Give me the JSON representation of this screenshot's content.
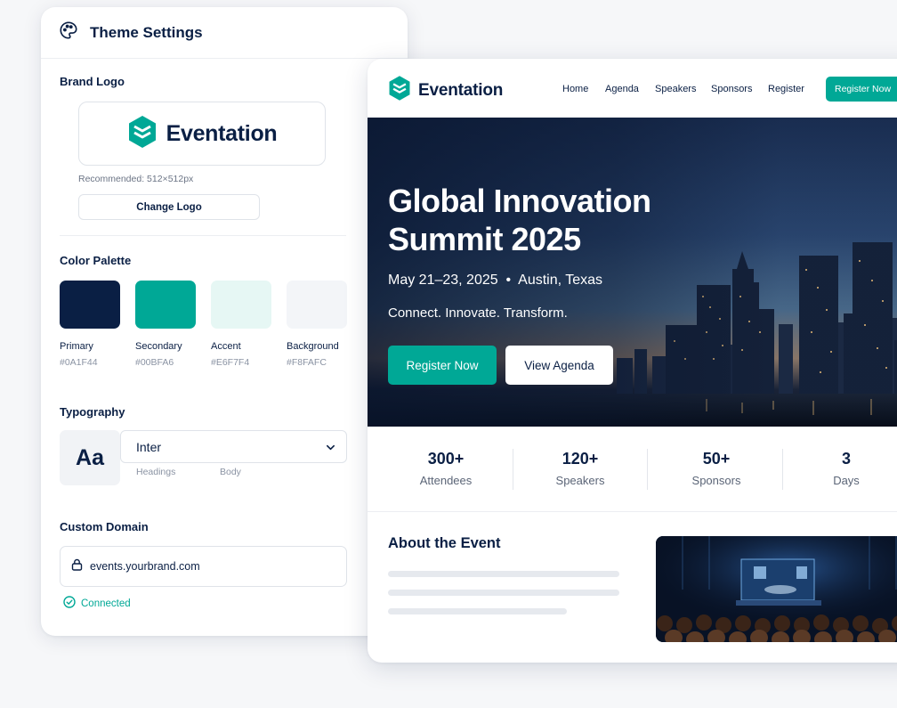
{
  "colors": {
    "primary": "#0A1F44",
    "secondary": "#00A896",
    "accent": "#E6F7F4",
    "background": "#F8FAFC"
  },
  "settings": {
    "title": "Theme Settings",
    "title_icon": "palette-icon",
    "brand_logo": {
      "label": "Brand Logo",
      "logo_text": "Eventation",
      "logo_icon": "hexagon-logo-icon",
      "recommendation": "Recommended: 512×512px",
      "change_button": "Change Logo"
    },
    "color_palette": {
      "label": "Color Palette",
      "swatches": [
        {
          "name": "Primary",
          "hex": "#0A1F44"
        },
        {
          "name": "Secondary",
          "hex": "#00BFA6"
        },
        {
          "name": "Accent",
          "hex": "#E6F7F4"
        },
        {
          "name": "Background",
          "hex": "#F8FAFC"
        }
      ]
    },
    "typography": {
      "label": "Typography",
      "preview": "Aa",
      "font": "Inter",
      "headings_label": "Headings",
      "body_label": "Body"
    },
    "custom_domain": {
      "label": "Custom Domain",
      "value": "events.yourbrand.com",
      "status": "Connected"
    }
  },
  "preview": {
    "nav": {
      "brand": "Eventation",
      "links": [
        "Home",
        "Agenda",
        "Speakers",
        "Sponsors",
        "Register"
      ],
      "cta": "Register Now"
    },
    "hero": {
      "title_line1": "Global Innovation",
      "title_line2": "Summit 2025",
      "date_location": "May 21–23, 2025  •  Austin, Texas",
      "tagline": "Connect. Innovate. Transform.",
      "primary_button": "Register Now",
      "secondary_button": "View Agenda"
    },
    "stats": [
      {
        "value": "300+",
        "label": "Attendees"
      },
      {
        "value": "120+",
        "label": "Speakers"
      },
      {
        "value": "50+",
        "label": "Sponsors"
      },
      {
        "value": "3",
        "label": "Days"
      }
    ],
    "about": {
      "title": "About the Event"
    }
  }
}
